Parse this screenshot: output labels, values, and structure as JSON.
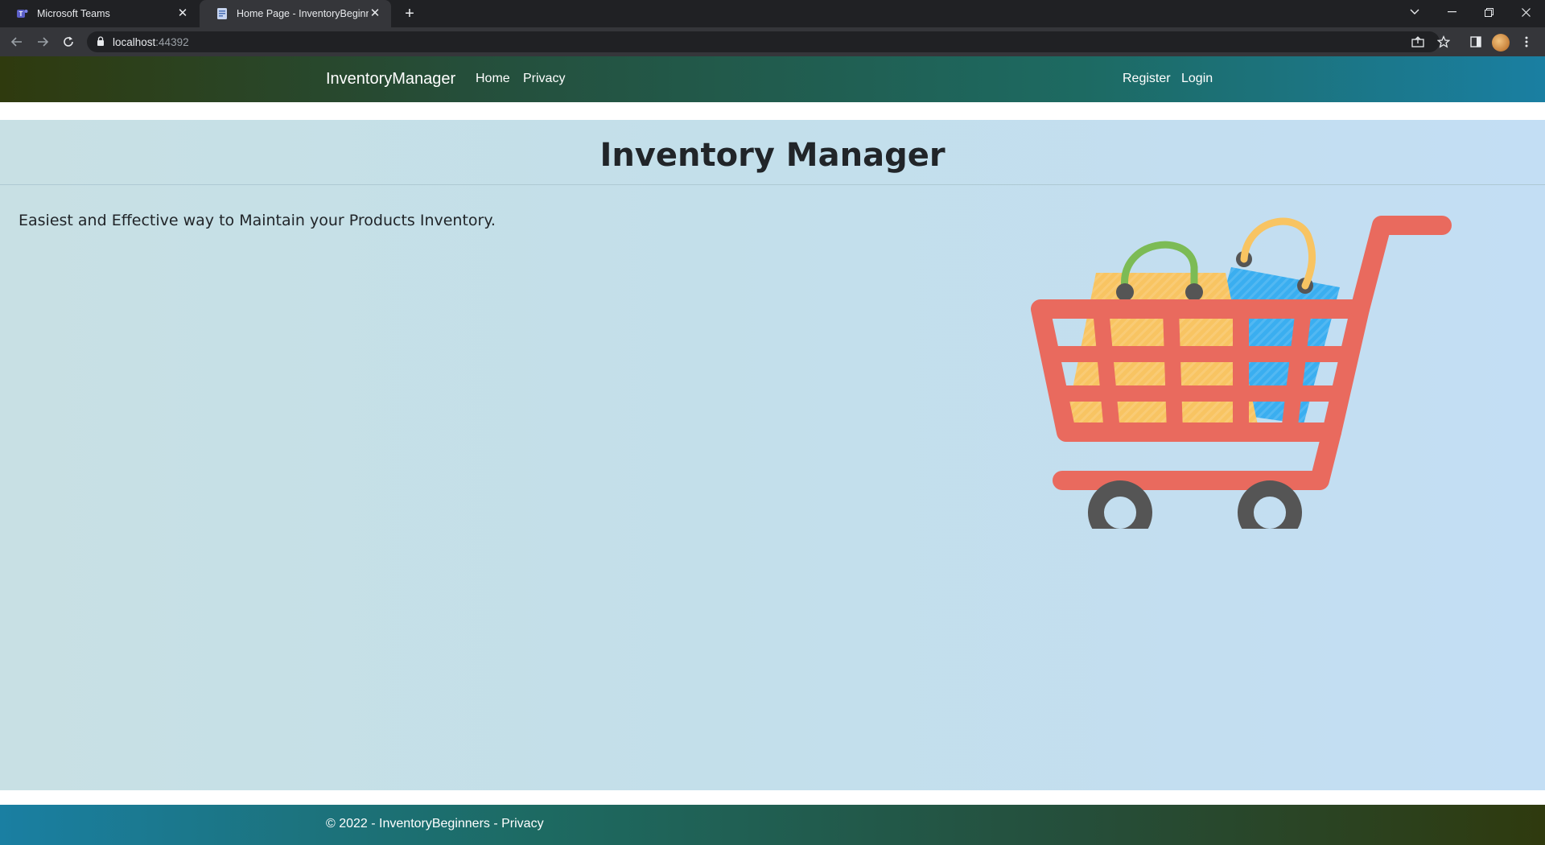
{
  "browser": {
    "tabs": [
      {
        "title": "Microsoft Teams",
        "icon": "teams-icon"
      },
      {
        "title": "Home Page - InventoryBeginners",
        "icon": "page-icon",
        "active": true
      }
    ],
    "address": {
      "host": "localhost",
      "port": ":44392"
    }
  },
  "navbar": {
    "brand": "InventoryManager",
    "links": [
      "Home",
      "Privacy"
    ],
    "auth_links": [
      "Register",
      "Login"
    ]
  },
  "hero": {
    "title": "Inventory Manager",
    "tagline": "Easiest and Effective way to Maintain your Products Inventory.",
    "illustration": "shopping-cart-icon"
  },
  "footer": {
    "copyright": "© 2022 - InventoryBeginners - ",
    "link": "Privacy"
  },
  "colors": {
    "navbar_start": "#2f3a0e",
    "navbar_end": "#1a7fa2",
    "hero_bg": "#c3dfea",
    "cart_red": "#e96a5e",
    "bag_yellow": "#f8c462",
    "tag_blue": "#3aaef0",
    "handle_green": "#7cbb55",
    "wheel_gray": "#555555"
  }
}
